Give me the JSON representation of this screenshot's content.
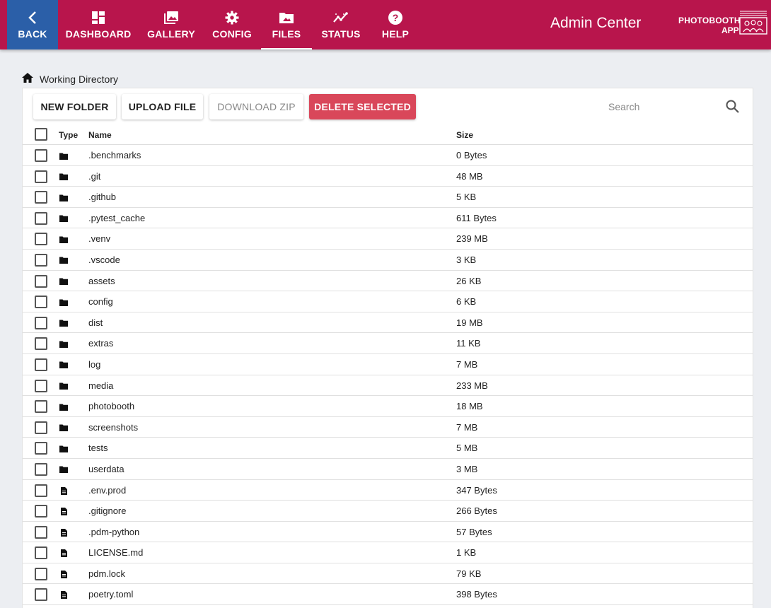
{
  "header": {
    "back_label": "BACK",
    "nav": [
      {
        "label": "DASHBOARD",
        "icon": "dashboard-icon"
      },
      {
        "label": "GALLERY",
        "icon": "gallery-icon"
      },
      {
        "label": "CONFIG",
        "icon": "gear-icon"
      },
      {
        "label": "FILES",
        "icon": "folder-image-icon",
        "active": true
      },
      {
        "label": "STATUS",
        "icon": "chart-line-icon"
      },
      {
        "label": "HELP",
        "icon": "help-icon"
      }
    ],
    "title": "Admin Center",
    "brand_line1": "PHOTOBOOTH",
    "brand_line2": "APP",
    "colors": {
      "bar": "#b8154c",
      "back": "#2b5fa8"
    }
  },
  "breadcrumb": {
    "label": "Working Directory",
    "icon": "home-icon"
  },
  "toolbar": {
    "new_folder": "NEW FOLDER",
    "upload_file": "UPLOAD FILE",
    "download_zip": "DOWNLOAD ZIP",
    "delete_selected": "DELETE SELECTED",
    "search_placeholder": "Search",
    "danger_color": "#d9475a"
  },
  "table": {
    "columns": {
      "type": "Type",
      "name": "Name",
      "size": "Size"
    },
    "rows": [
      {
        "type": "folder",
        "name": ".benchmarks",
        "size": "0 Bytes"
      },
      {
        "type": "folder",
        "name": ".git",
        "size": "48 MB"
      },
      {
        "type": "folder",
        "name": ".github",
        "size": "5 KB"
      },
      {
        "type": "folder",
        "name": ".pytest_cache",
        "size": "611 Bytes"
      },
      {
        "type": "folder",
        "name": ".venv",
        "size": "239 MB"
      },
      {
        "type": "folder",
        "name": ".vscode",
        "size": "3 KB"
      },
      {
        "type": "folder",
        "name": "assets",
        "size": "26 KB"
      },
      {
        "type": "folder",
        "name": "config",
        "size": "6 KB"
      },
      {
        "type": "folder",
        "name": "dist",
        "size": "19 MB"
      },
      {
        "type": "folder",
        "name": "extras",
        "size": "11 KB"
      },
      {
        "type": "folder",
        "name": "log",
        "size": "7 MB"
      },
      {
        "type": "folder",
        "name": "media",
        "size": "233 MB"
      },
      {
        "type": "folder",
        "name": "photobooth",
        "size": "18 MB"
      },
      {
        "type": "folder",
        "name": "screenshots",
        "size": "7 MB"
      },
      {
        "type": "folder",
        "name": "tests",
        "size": "5 MB"
      },
      {
        "type": "folder",
        "name": "userdata",
        "size": "3 MB"
      },
      {
        "type": "file",
        "name": ".env.prod",
        "size": "347 Bytes"
      },
      {
        "type": "file",
        "name": ".gitignore",
        "size": "266 Bytes"
      },
      {
        "type": "file",
        "name": ".pdm-python",
        "size": "57 Bytes"
      },
      {
        "type": "file",
        "name": "LICENSE.md",
        "size": "1 KB"
      },
      {
        "type": "file",
        "name": "pdm.lock",
        "size": "79 KB"
      },
      {
        "type": "file",
        "name": "poetry.toml",
        "size": "398 Bytes"
      }
    ]
  }
}
